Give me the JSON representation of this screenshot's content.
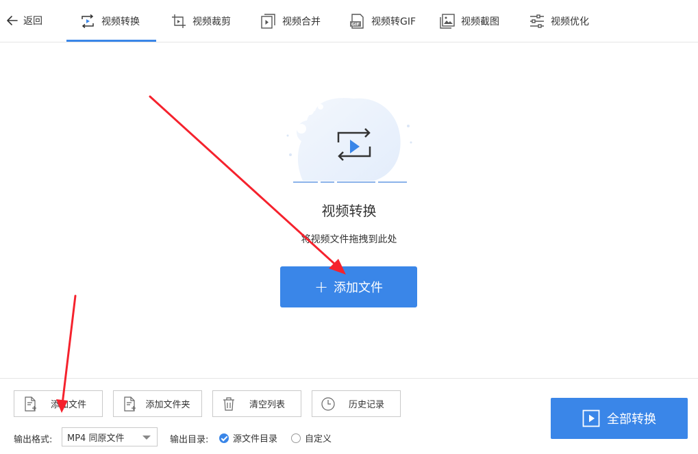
{
  "nav": {
    "back_label": "返回",
    "tabs": [
      {
        "label": "视频转换",
        "icon": "video-convert-icon",
        "active": true
      },
      {
        "label": "视频裁剪",
        "icon": "video-crop-icon",
        "active": false
      },
      {
        "label": "视频合并",
        "icon": "video-merge-icon",
        "active": false
      },
      {
        "label": "视频转GIF",
        "icon": "video-gif-icon",
        "active": false
      },
      {
        "label": "视频截图",
        "icon": "video-screenshot-icon",
        "active": false
      },
      {
        "label": "视频优化",
        "icon": "video-optimize-icon",
        "active": false
      }
    ]
  },
  "hero": {
    "title": "视频转换",
    "hint": "将视频文件拖拽到此处",
    "add_button": "添加文件"
  },
  "toolbar": {
    "add_file": "添加文件",
    "add_folder": "添加文件夹",
    "clear_list": "清空列表",
    "history": "历史记录"
  },
  "output": {
    "format_label": "输出格式:",
    "format_value": "MP4 同原文件",
    "dir_label": "输出目录:",
    "dir_source": "源文件目录",
    "dir_custom": "自定义",
    "selected": "source"
  },
  "convert_all_label": "全部转换",
  "colors": {
    "accent": "#3a86e8",
    "annotation": "#f5222d"
  }
}
